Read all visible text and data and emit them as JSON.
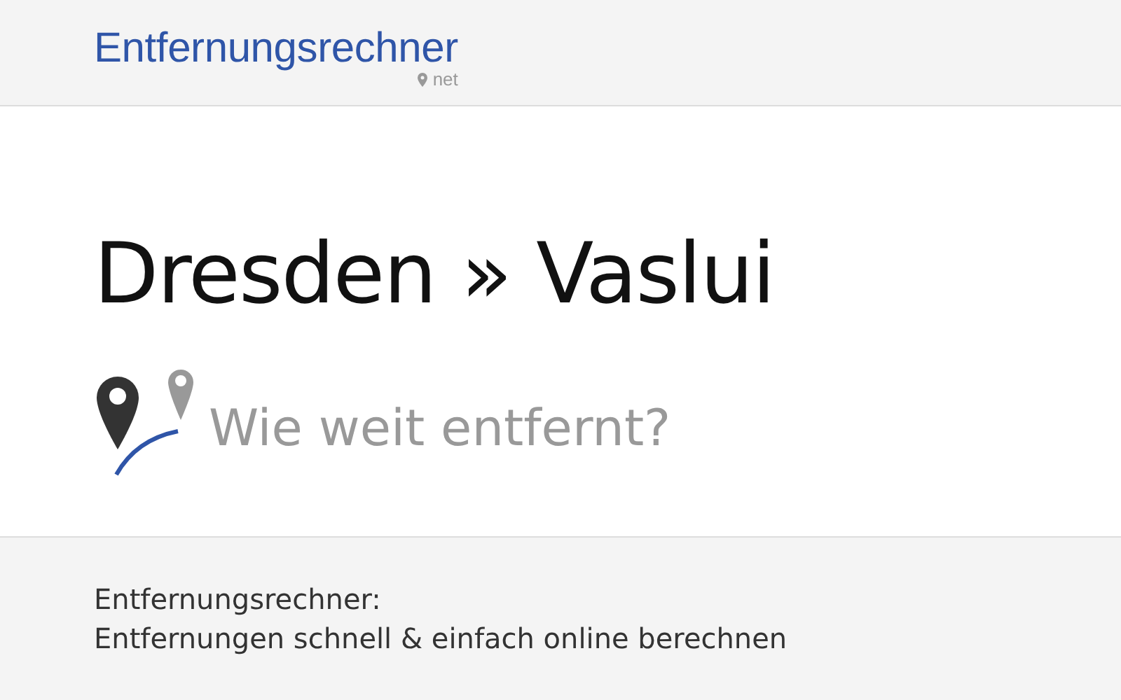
{
  "header": {
    "logo": "Entfernungsrechner",
    "logo_suffix": "net"
  },
  "title": "Dresden » Vaslui",
  "subtitle": "Wie weit entfernt?",
  "footer": {
    "heading": "Entfernungsrechner:",
    "tagline": "Entfernungen schnell & einfach online berechnen"
  }
}
